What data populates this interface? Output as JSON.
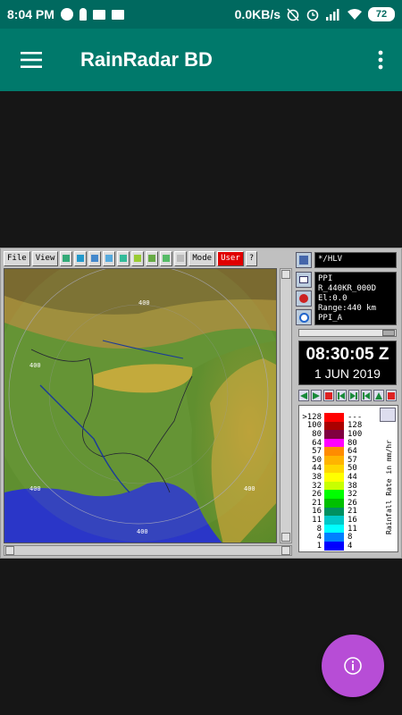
{
  "status_bar": {
    "time": "8:04 PM",
    "net_speed": "0.0KB/s",
    "battery": "72"
  },
  "app_bar": {
    "title": "RainRadar BD",
    "menu_icon": "hamburger-menu-icon",
    "overflow_icon": "more-vert-icon"
  },
  "radar": {
    "toolbar": {
      "file_label": "File",
      "view_label": "View",
      "mode_label": "Mode",
      "user_label": "User",
      "help_label": "?"
    },
    "map": {
      "range_labels": [
        "400",
        "400",
        "400",
        "400",
        "400"
      ]
    },
    "product": "*/HLV",
    "info": [
      "PPI",
      "R_440KR_000D",
      "El:0.0",
      "Range:440 km",
      "PPI_A"
    ],
    "time": "08:30:05 Z",
    "date": "1 JUN 2019",
    "legend": {
      "label": "Rainfall Rate in mm/hr",
      "rows": [
        {
          "low": ">128",
          "high": "---",
          "color": "#ff0000"
        },
        {
          "low": "100",
          "high": "128",
          "color": "#aa0000"
        },
        {
          "low": "80",
          "high": "100",
          "color": "#800040"
        },
        {
          "low": "64",
          "high": "80",
          "color": "#ff00ff"
        },
        {
          "low": "57",
          "high": "64",
          "color": "#ff8c00"
        },
        {
          "low": "50",
          "high": "57",
          "color": "#ffb400"
        },
        {
          "low": "44",
          "high": "50",
          "color": "#ffd700"
        },
        {
          "low": "38",
          "high": "44",
          "color": "#ffff00"
        },
        {
          "low": "32",
          "high": "38",
          "color": "#c8ff00"
        },
        {
          "low": "26",
          "high": "32",
          "color": "#00ff00"
        },
        {
          "low": "21",
          "high": "26",
          "color": "#00c000"
        },
        {
          "low": "16",
          "high": "21",
          "color": "#009060"
        },
        {
          "low": "11",
          "high": "16",
          "color": "#00c8c8"
        },
        {
          "low": "8",
          "high": "11",
          "color": "#00ffff"
        },
        {
          "low": "4",
          "high": "8",
          "color": "#0080ff"
        },
        {
          "low": "1",
          "high": "4",
          "color": "#0000ff"
        }
      ]
    }
  },
  "fab": {
    "icon": "info-icon"
  }
}
